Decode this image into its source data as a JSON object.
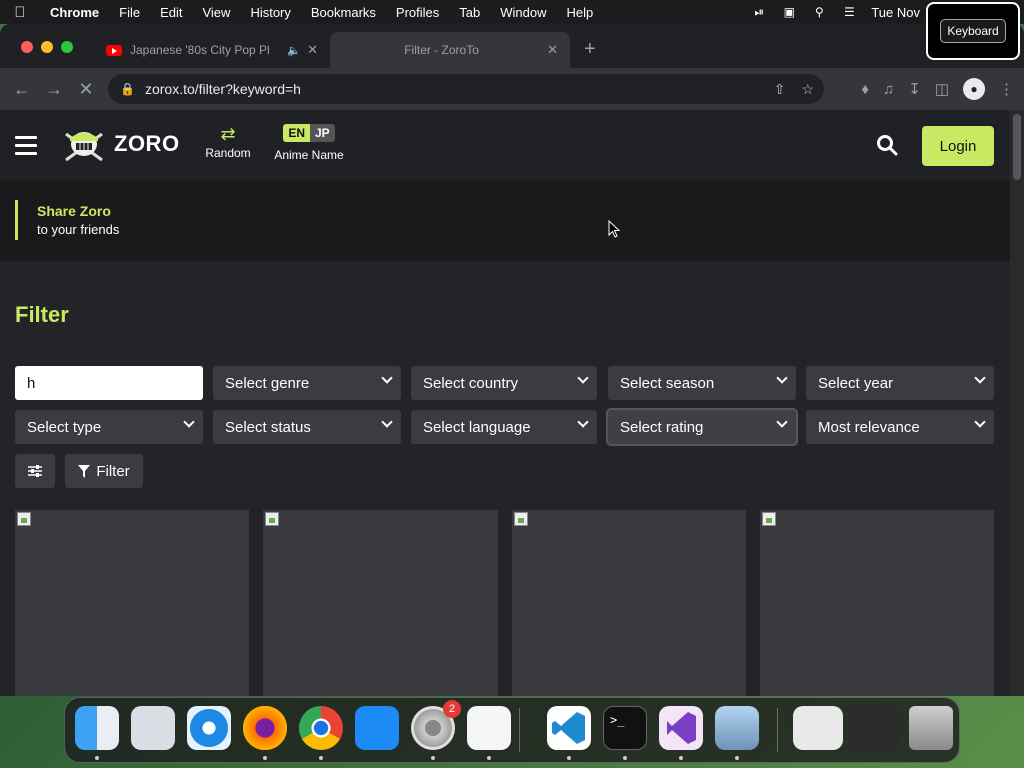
{
  "menubar": {
    "app_name": "Chrome",
    "items": [
      "File",
      "Edit",
      "View",
      "History",
      "Bookmarks",
      "Profiles",
      "Tab",
      "Window",
      "Help"
    ],
    "clock": "Tue Nov"
  },
  "keyboard_popup": "Keyboard",
  "tabs": [
    {
      "title": "Japanese '80s City Pop Pl",
      "icon": "youtube-icon",
      "audio": true
    },
    {
      "title": "Filter - ZoroTo",
      "active": true
    }
  ],
  "address_bar": {
    "url": "zorox.to/filter?keyword=h"
  },
  "site": {
    "logo_text": "ZORO",
    "nav": {
      "random_label": "Random",
      "lang_en": "EN",
      "lang_jp": "JP",
      "lang_label": "Anime Name"
    },
    "login_label": "Login",
    "share_title": "Share Zoro",
    "share_sub": "to your friends"
  },
  "filter": {
    "title": "Filter",
    "keyword_value": "h",
    "selects": {
      "genre": "Select genre",
      "country": "Select country",
      "season": "Select season",
      "year": "Select year",
      "type": "Select type",
      "status": "Select status",
      "language": "Select language",
      "rating": "Select rating",
      "sort": "Most relevance"
    },
    "filter_button": "Filter"
  },
  "colors": {
    "accent": "#cae962",
    "page_bg": "#242428",
    "field_bg": "#3b3c40"
  },
  "dock": {
    "settings_badge": "2"
  }
}
